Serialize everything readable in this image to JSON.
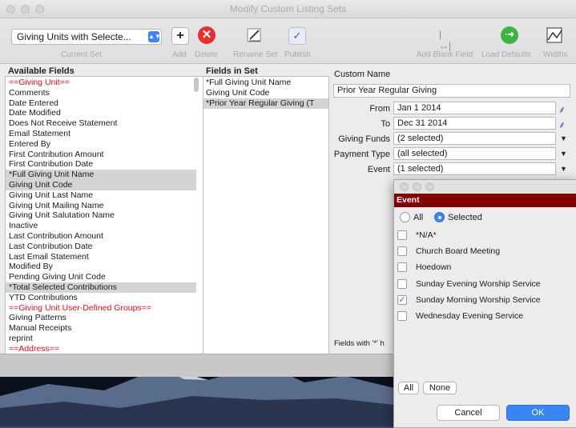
{
  "window": {
    "title": "Modify Custom Listing Sets"
  },
  "toolbar": {
    "current_set_value": "Giving Units with Selecte...",
    "current_set_label": "Current Set",
    "add_label": "Add",
    "delete_label": "Delete",
    "rename_label": "Rename Set",
    "publish_label": "Publish",
    "add_blank_label": "Add Blank Field",
    "load_defaults_label": "Load Defaults",
    "widths_label": "Widths"
  },
  "available": {
    "header": "Available Fields",
    "items": [
      {
        "text": "==Giving Unit==",
        "red": true,
        "sel": false
      },
      {
        "text": "Comments",
        "red": false,
        "sel": false
      },
      {
        "text": "Date Entered",
        "red": false,
        "sel": false
      },
      {
        "text": "Date Modified",
        "red": false,
        "sel": false
      },
      {
        "text": "Does Not Receive Statement",
        "red": false,
        "sel": false
      },
      {
        "text": "Email Statement",
        "red": false,
        "sel": false
      },
      {
        "text": "Entered By",
        "red": false,
        "sel": false
      },
      {
        "text": "First Contribution Amount",
        "red": false,
        "sel": false
      },
      {
        "text": "First Contribution Date",
        "red": false,
        "sel": false
      },
      {
        "text": "*Full Giving Unit Name",
        "red": false,
        "sel": true
      },
      {
        "text": "Giving Unit Code",
        "red": false,
        "sel": true
      },
      {
        "text": "Giving Unit Last Name",
        "red": false,
        "sel": false
      },
      {
        "text": "Giving Unit Mailing Name",
        "red": false,
        "sel": false
      },
      {
        "text": "Giving Unit Salutation Name",
        "red": false,
        "sel": false
      },
      {
        "text": "Inactive",
        "red": false,
        "sel": false
      },
      {
        "text": "Last Contribution Amount",
        "red": false,
        "sel": false
      },
      {
        "text": "Last Contribution Date",
        "red": false,
        "sel": false
      },
      {
        "text": "Last Email Statement",
        "red": false,
        "sel": false
      },
      {
        "text": "Modified By",
        "red": false,
        "sel": false
      },
      {
        "text": "Pending Giving Unit Code",
        "red": false,
        "sel": false
      },
      {
        "text": "*Total Selected Contributions",
        "red": false,
        "sel": true
      },
      {
        "text": "YTD Contributions",
        "red": false,
        "sel": false
      },
      {
        "text": "==Giving Unit User-Defined Groups==",
        "red": true,
        "sel": false
      },
      {
        "text": "Giving Patterns",
        "red": false,
        "sel": false
      },
      {
        "text": "Manual Receipts",
        "red": false,
        "sel": false
      },
      {
        "text": "reprint",
        "red": false,
        "sel": false
      },
      {
        "text": "==Address==",
        "red": true,
        "sel": false
      }
    ]
  },
  "inset": {
    "header": "Fields in Set",
    "items": [
      {
        "text": "*Full Giving Unit Name",
        "sel": false
      },
      {
        "text": "Giving Unit Code",
        "sel": false
      },
      {
        "text": "*Prior Year Regular Giving (T",
        "sel": true
      }
    ]
  },
  "form": {
    "custom_name_label": "Custom Name",
    "custom_name_value": "Prior Year Regular Giving",
    "from_label": "From",
    "from_value": "Jan 1 2014",
    "to_label": "To",
    "to_value": "Dec 31 2014",
    "funds_label": "Giving Funds",
    "funds_value": "(2 selected)",
    "payment_label": "Payment Type",
    "payment_value": "(all selected)",
    "event_label": "Event",
    "event_value": "(1 selected)",
    "footnote": "Fields with '*' h"
  },
  "popup": {
    "header": "Event",
    "all_label": "All",
    "selected_label": "Selected",
    "items": [
      {
        "text": "*N/A*",
        "checked": false
      },
      {
        "text": "Church Board Meeting",
        "checked": false
      },
      {
        "text": "Hoedown",
        "checked": false
      },
      {
        "text": "Sunday Evening Worship Service",
        "checked": false
      },
      {
        "text": "Sunday Morning Worship Service",
        "checked": true
      },
      {
        "text": "Wednesday Evening Service",
        "checked": false
      }
    ],
    "btn_all": "All",
    "btn_none": "None",
    "btn_cancel": "Cancel",
    "btn_ok": "OK"
  },
  "colors": {
    "accent": "#3a86f6",
    "red_header": "#820000",
    "delete_red": "#e53030",
    "load_green": "#3fb23f"
  }
}
